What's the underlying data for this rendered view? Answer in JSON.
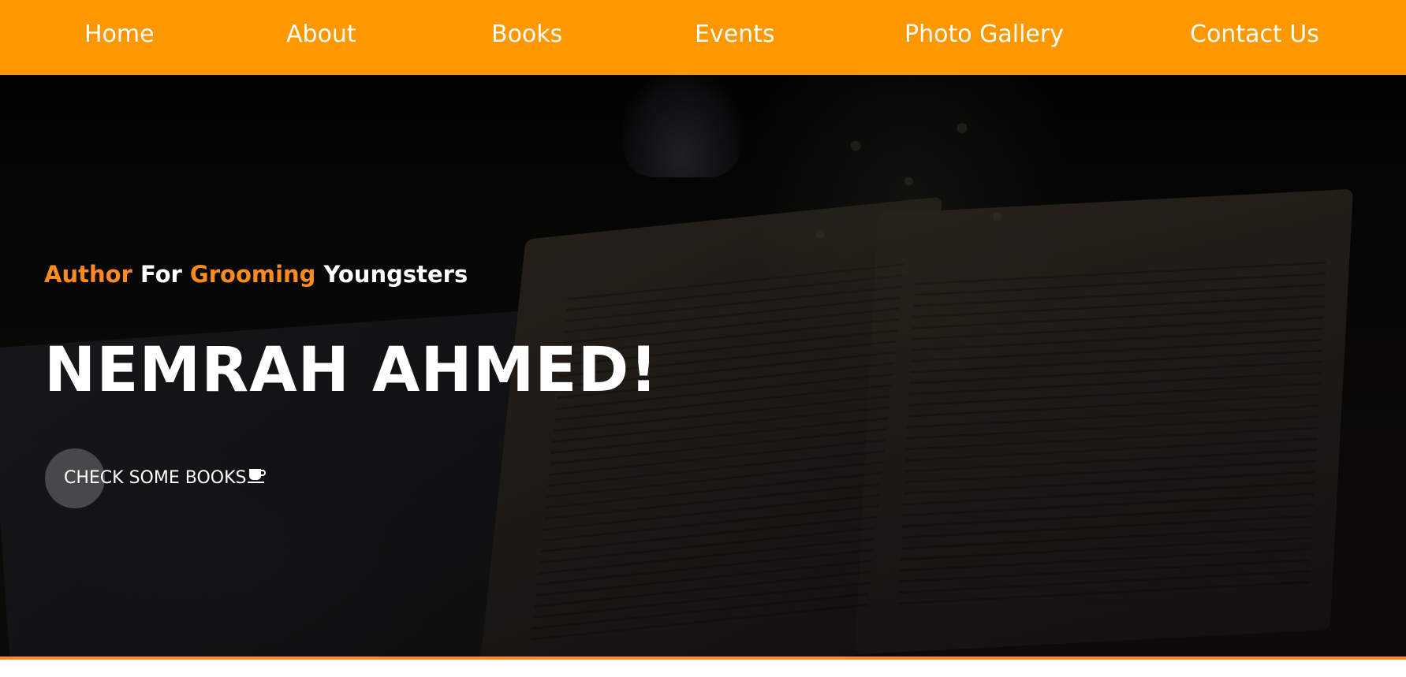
{
  "nav": {
    "items": [
      "Home",
      "About",
      "Books",
      "Events",
      "Photo Gallery",
      "Contact Us"
    ]
  },
  "hero": {
    "tagline": {
      "word1": "Author",
      "word2": "For",
      "word3": "Grooming",
      "word4": "Youngsters"
    },
    "title": "NEMRAH AHMED!",
    "cta_label": "CHECK SOME BOOKS",
    "cta_icon": "coffee-cup-icon"
  },
  "colors": {
    "nav_bg": "#ff9800",
    "accent": "#ff8a1f",
    "text": "#ffffff",
    "hero_bg": "#0d0c0b"
  }
}
